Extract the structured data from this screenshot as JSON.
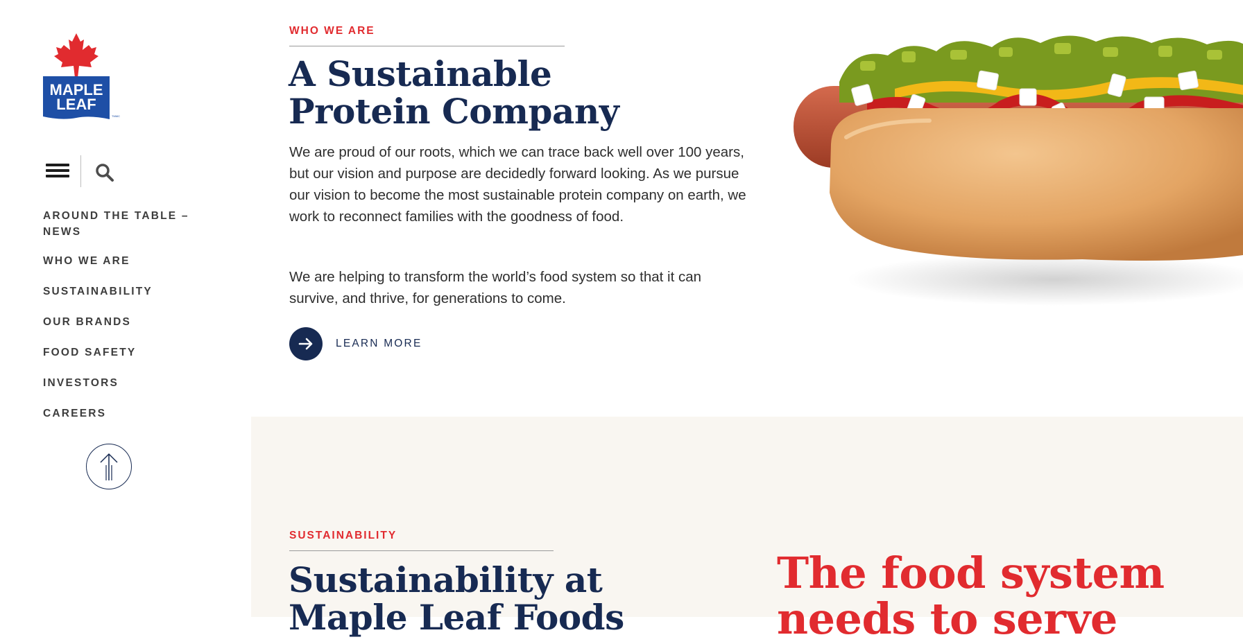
{
  "brand": {
    "logo_line1": "MAPLE",
    "logo_line2": "LEAF",
    "logo_tm": "TMMC",
    "colors": {
      "navy": "#172a52",
      "red": "#e12b2f",
      "blue": "#1e4fa6",
      "cream": "#f9f6f1"
    }
  },
  "sidebar": {
    "menu_icon": "hamburger-menu-icon",
    "search_icon": "search-icon",
    "nav": [
      "AROUND THE TABLE – NEWS",
      "WHO WE ARE",
      "SUSTAINABILITY",
      "OUR BRANDS",
      "FOOD SAFETY",
      "INVESTORS",
      "CAREERS"
    ],
    "to_top_icon": "arrow-up-icon"
  },
  "who_we_are": {
    "eyebrow": "WHO WE ARE",
    "heading_line1": "A Sustainable",
    "heading_line2": "Protein Company",
    "paragraph1": "We are proud of our roots, which we can trace back well over 100 years, but our vision and purpose are decidedly forward looking. As we pursue our vision to become the most sustainable protein company on earth, we work to reconnect families with the goodness of food.",
    "paragraph2": "We are helping to transform the world’s food system so that it can survive, and thrive, for generations to come.",
    "learn_more": "LEARN MORE",
    "learn_more_icon": "arrow-right-icon",
    "image": "hot-dog-image"
  },
  "sustainability": {
    "eyebrow": "SUSTAINABILITY",
    "heading_line1": "Sustainability at",
    "heading_line2": "Maple Leaf Foods",
    "red_line1": "The food system",
    "red_line2": "needs to serve"
  }
}
